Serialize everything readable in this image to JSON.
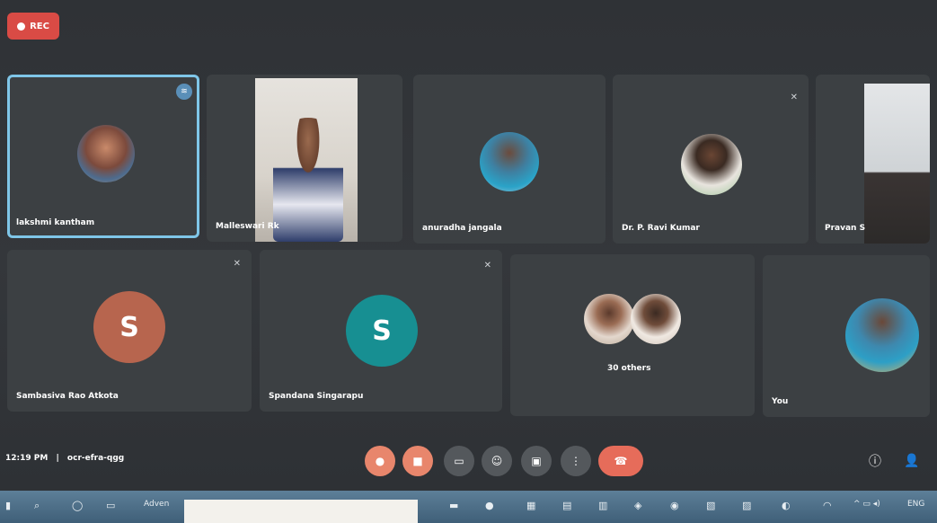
{
  "rec_label": "REC",
  "participants": [
    {
      "name": "lakshmi kantham"
    },
    {
      "name": "Malleswari Rk"
    },
    {
      "name": "anuradha jangala"
    },
    {
      "name": "Dr. P. Ravi Kumar"
    },
    {
      "name": "Pravan S"
    },
    {
      "name": "Sambasiva Rao Atkota",
      "initial": "S"
    },
    {
      "name": "Spandana Singarapu",
      "initial": "S"
    },
    {
      "name": "30 others"
    },
    {
      "name": "You"
    }
  ],
  "bottom_bar": {
    "time": "12:19 PM",
    "separator": "|",
    "meeting_code": "ocr-efra-qgg"
  },
  "taskbar": {
    "search_text": "Adven"
  },
  "colors": {
    "rec": "#d94b45",
    "end_call": "#e66c5a",
    "mic_btn": "#e8866c",
    "avatar_s1": "#b7654e",
    "avatar_s2": "#178f92",
    "active_border": "#7fc6e8"
  }
}
